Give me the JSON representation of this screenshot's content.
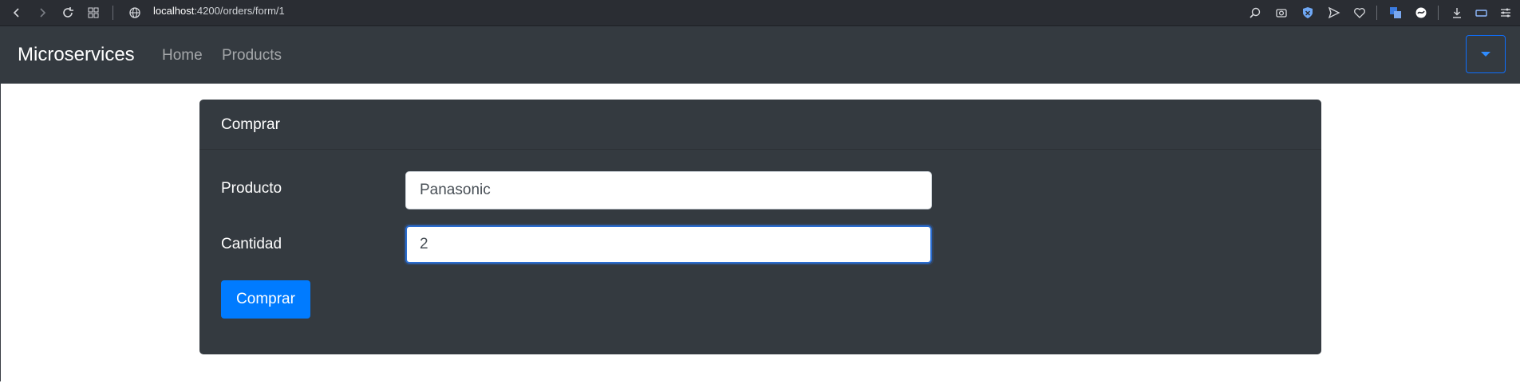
{
  "browser": {
    "url_host": "localhost",
    "url_path": ":4200/orders/form/1"
  },
  "navbar": {
    "brand": "Microservices",
    "links": [
      {
        "label": "Home"
      },
      {
        "label": "Products"
      }
    ],
    "toggle_color": "#0d6efd"
  },
  "card": {
    "header_title": "Comprar",
    "fields": [
      {
        "label": "Producto",
        "value": "Panasonic"
      },
      {
        "label": "Cantidad",
        "value": "2"
      }
    ],
    "submit_label": "Comprar",
    "submit_color": "#007bff",
    "background": "#343a40"
  }
}
